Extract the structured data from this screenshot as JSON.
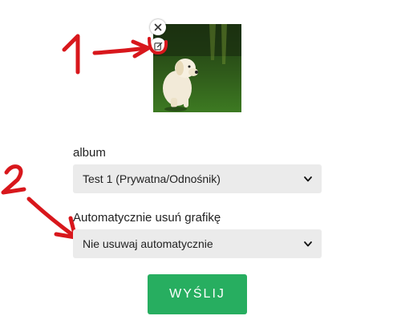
{
  "image": {
    "alt": "",
    "close_icon": "close-icon",
    "edit_icon": "edit-icon"
  },
  "annotations": {
    "mark_1": "1",
    "mark_2": "2",
    "color": "#d8171c"
  },
  "form": {
    "album_label": "album",
    "album_value": "Test 1 (Prywatna/Odnośnik)",
    "auto_delete_label": "Automatycznie usuń grafikę",
    "auto_delete_value": "Nie usuwaj automatycznie",
    "submit_label": "WYŚLIJ"
  },
  "colors": {
    "submit_bg": "#27ae60",
    "select_bg": "#ebebeb"
  }
}
